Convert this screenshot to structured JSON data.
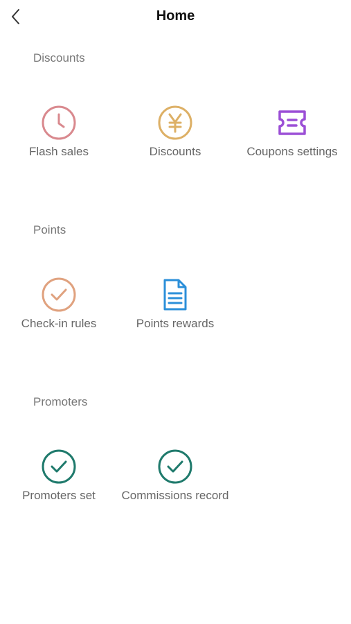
{
  "header": {
    "title": "Home",
    "back_icon": "chevron-left-icon"
  },
  "sections": [
    {
      "title": "Discounts",
      "tiles": [
        {
          "label": "Flash sales",
          "icon": "clock-icon",
          "color": "#d9898e"
        },
        {
          "label": "Discounts",
          "icon": "yen-icon",
          "color": "#ddb066"
        },
        {
          "label": "Coupons settings",
          "icon": "coupon-icon",
          "color": "#9b4fd6"
        }
      ]
    },
    {
      "title": "Points",
      "tiles": [
        {
          "label": "Check-in rules",
          "icon": "check-circle-icon",
          "color": "#e0a27f"
        },
        {
          "label": "Points rewards",
          "icon": "document-icon",
          "color": "#2b8fd9"
        }
      ]
    },
    {
      "title": "Promoters",
      "tiles": [
        {
          "label": "Promoters set",
          "icon": "check-circle-icon",
          "color": "#1f7a6c"
        },
        {
          "label": "Commissions record",
          "icon": "check-circle-icon",
          "color": "#1f7a6c"
        }
      ]
    }
  ]
}
